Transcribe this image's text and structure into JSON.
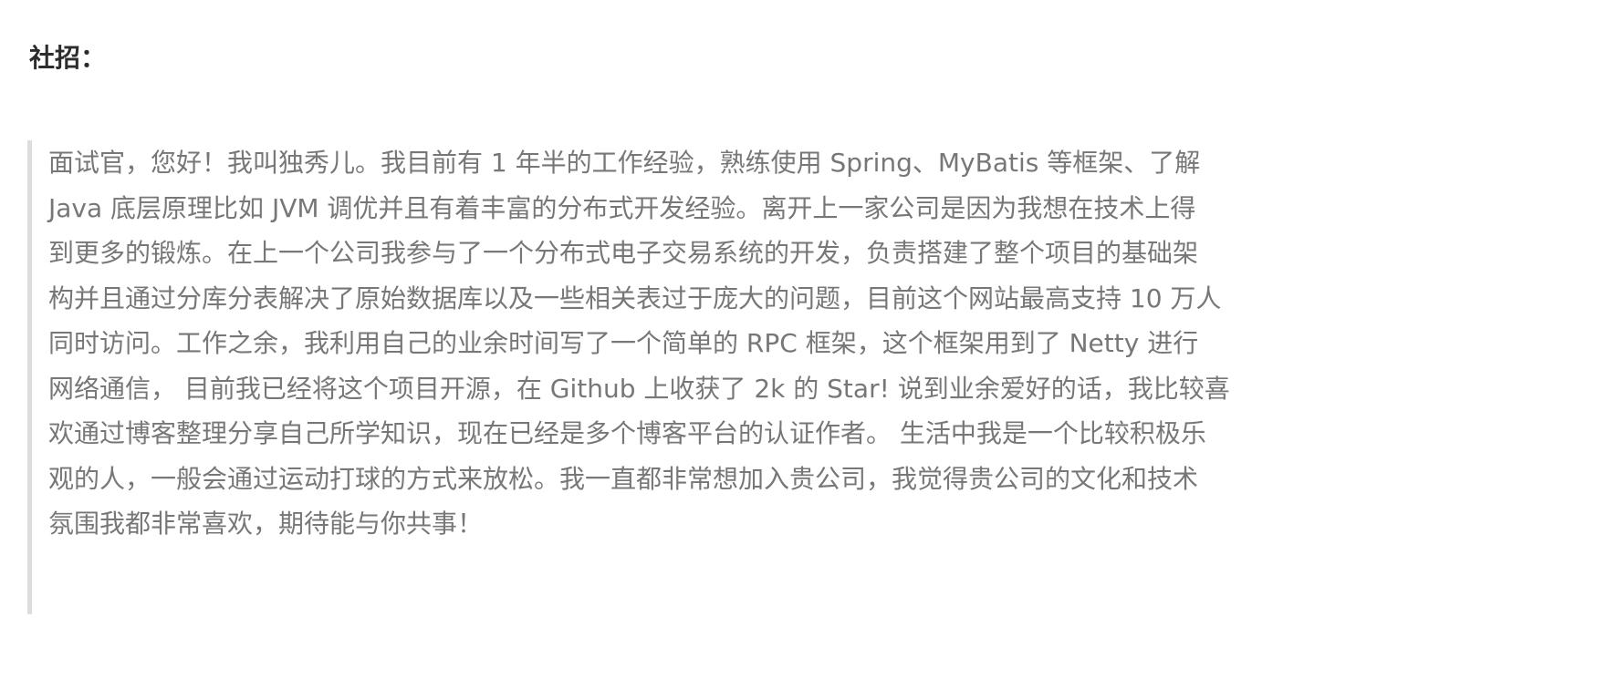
{
  "heading": "社招：",
  "intro_lines": [
    "面试官，您好！我叫独秀儿。我目前有 1 年半的工作经验，熟练使用 Spring、MyBatis 等框架、了解",
    "Java 底层原理比如 JVM 调优并且有着丰富的分布式开发经验。离开上一家公司是因为我想在技术上得",
    "到更多的锻炼。在上一个公司我参与了一个分布式电子交易系统的开发，负责搭建了整个项目的基础架",
    "构并且通过分库分表解决了原始数据库以及一些相关表过于庞大的问题，目前这个网站最高支持 10 万人",
    "同时访问。工作之余，我利用自己的业余时间写了一个简单的 RPC 框架，这个框架用到了 Netty 进行",
    "网络通信， 目前我已经将这个项目开源，在 Github 上收获了 2k 的 Star! 说到业余爱好的话，我比较喜",
    "欢通过博客整理分享自己所学知识，现在已经是多个博客平台的认证作者。 生活中我是一个比较积极乐",
    "观的人，一般会通过运动打球的方式来放松。我一直都非常想加入贵公司，我觉得贵公司的文化和技术",
    "氛围我都非常喜欢，期待能与你共事！"
  ]
}
